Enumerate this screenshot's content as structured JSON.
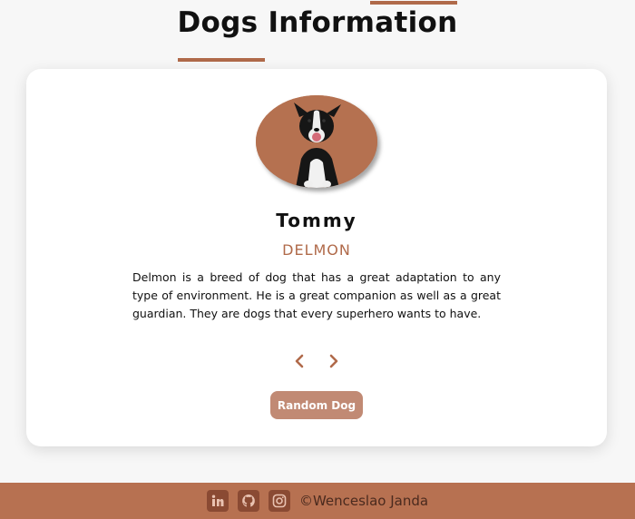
{
  "header": {
    "title": "Dogs Information"
  },
  "card": {
    "dog_name": "Tommy",
    "breed": "DELMON",
    "description": "Delmon is a breed of dog that has a great adaptation to any type of environment. He is a great companion as well as a great guardian. They are dogs that every superhero wants to have.",
    "random_button_label": "Random Dog"
  },
  "footer": {
    "credit": "©Wenceslao Janda",
    "icons": [
      "linkedin-icon",
      "github-icon",
      "instagram-icon"
    ]
  },
  "colors": {
    "accent": "#b06a4a",
    "button": "#c18a74",
    "footer": "#b77151"
  }
}
